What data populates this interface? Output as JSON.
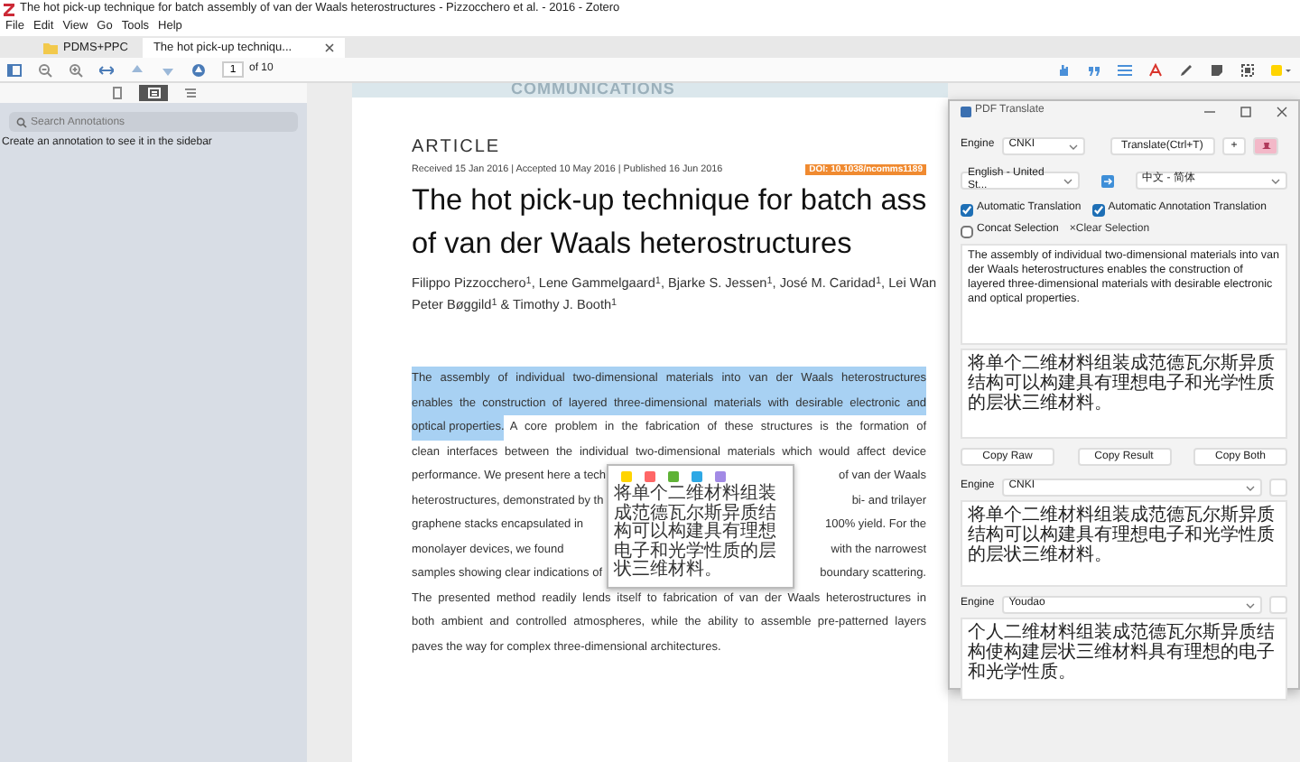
{
  "window": {
    "title": "The hot pick-up technique for batch assembly of van der Waals heterostructures - Pizzocchero et al. - 2016 - Zotero"
  },
  "menu": [
    "File",
    "Edit",
    "View",
    "Go",
    "Tools",
    "Help"
  ],
  "tabs": [
    {
      "label": "PDMS+PPC",
      "kind": "library",
      "selected": false
    },
    {
      "label": "The hot pick-up techniqu...",
      "kind": "reader",
      "selected": true
    }
  ],
  "toolbar": {
    "page": "1",
    "page_count": "of 10"
  },
  "sidebar": {
    "views": [
      {
        "kind": "thumbnails",
        "selected": false
      },
      {
        "kind": "annotations",
        "selected": true
      },
      {
        "kind": "outline",
        "selected": false
      }
    ],
    "search": {
      "placeholder": "Search Annotations"
    },
    "message": "Create an annotation to see it in the sidebar"
  },
  "document": {
    "journal": "COMMUNICATIONS",
    "section": "ARTICLE",
    "dates": "Received 15 Jan 2016 | Accepted 10 May 2016 | Published 16 Jun 2016",
    "doi": "DOI: 10.1038/ncomms1189",
    "title_lines": [
      "The hot pick-up technique for batch ass",
      "of van der Waals heterostructures"
    ],
    "author_lines": [
      "Filippo Pizzocchero$^{1}$, Lene Gammelgaard$^{1}$, Bjarke S. Jessen$^{1}$, José M. Caridad$^{1}$, Lei Wan",
      "Peter Bøggild$^{1}$ & Timothy J. Booth$^{1}$"
    ],
    "abstract_lines": [
      {
        "segments": [
          {
            "text": "The assembly of individual two-dimensional materials into van der Waals heterostructures",
            "highlighted": true
          }
        ]
      },
      {
        "segments": [
          {
            "text": "enables the construction of layered three-dimensional materials with desirable electronic and",
            "highlighted": true
          }
        ]
      },
      {
        "segments": [
          {
            "text": "optical properties.",
            "highlighted": true
          },
          {
            "text": "A core problem in the fabrication of these structures is the formation of",
            "highlighted": false
          }
        ]
      },
      {
        "segments": [
          {
            "text": "clean interfaces between the individual two-dimensional materials which would affect device",
            "highlighted": false
          }
        ]
      },
      {
        "segments": [
          {
            "text": "performance. We present here a tech",
            "highlighted": false
          },
          {
            "text": "of van der Waals",
            "highlighted": false
          }
        ]
      },
      {
        "segments": [
          {
            "text": "heterostructures, demonstrated by th",
            "highlighted": false
          },
          {
            "text": "bi- and trilayer",
            "highlighted": false
          }
        ]
      },
      {
        "segments": [
          {
            "text": "graphene stacks encapsulated in",
            "highlighted": false
          },
          {
            "text": "100% yield. For the",
            "highlighted": false
          }
        ]
      },
      {
        "segments": [
          {
            "text": "monolayer devices, we found",
            "highlighted": false
          },
          {
            "text": "with the narrowest",
            "highlighted": false
          }
        ]
      },
      {
        "segments": [
          {
            "text": "samples showing clear indications of",
            "highlighted": false
          },
          {
            "text": "boundary scattering.",
            "highlighted": false
          }
        ]
      },
      {
        "segments": [
          {
            "text": "The presented method readily lends itself to fabrication of van der Waals heterostructures in",
            "highlighted": false
          }
        ]
      },
      {
        "segments": [
          {
            "text": "both ambient and controlled atmospheres, while the ability to assemble pre-patterned layers",
            "highlighted": false
          }
        ]
      },
      {
        "segments": [
          {
            "text": "paves the way for complex three-dimensional architectures.",
            "highlighted": false
          }
        ]
      }
    ]
  },
  "popup": {
    "colors": [
      {
        "color": "#ffd400"
      },
      {
        "color": "#ff6666"
      },
      {
        "color": "#5fb236"
      },
      {
        "color": "#2ea8e5"
      },
      {
        "color": "#a28ae5"
      }
    ],
    "translation": "将单个二维材料组装成范德瓦尔斯异质结构可以构建具有理想电子和光学性质的层状三维材料。"
  },
  "translator": {
    "title": "PDF Translate",
    "engine_label": "Engine",
    "engine": "CNKI",
    "translate_button": "Translate(Ctrl+T)",
    "add_button": "+",
    "pinned": true,
    "source_language": "English - United St...",
    "target_language": "中文 - 简体",
    "options": [
      {
        "label": "Automatic Translation",
        "checked": true
      },
      {
        "label": "Automatic Annotation Translation",
        "checked": true
      },
      {
        "label": "Concat Selection",
        "checked": false
      }
    ],
    "clear_link": "×Clear Selection",
    "source_text": "The assembly of individual two-dimensional materials into van der Waals heterostructures enables the construction of layered three-dimensional materials with desirable electronic and optical properties.",
    "result": "将单个二维材料组装成范德瓦尔斯异质结构可以构建具有理想电子和光学性质的层状三维材料。",
    "copy_buttons": [
      "Copy Raw",
      "Copy Result",
      "Copy Both"
    ],
    "extra_engines": [
      {
        "label": "Engine",
        "engine": "CNKI",
        "result": "将单个二维材料组装成范德瓦尔斯异质结构可以构建具有理想电子和光学性质的层状三维材料。"
      },
      {
        "label": "Engine",
        "engine": "Youdao",
        "result": "个人二维材料组装成范德瓦尔斯异质结构使构建层状三维材料具有理想的电子和光学性质。"
      }
    ]
  }
}
